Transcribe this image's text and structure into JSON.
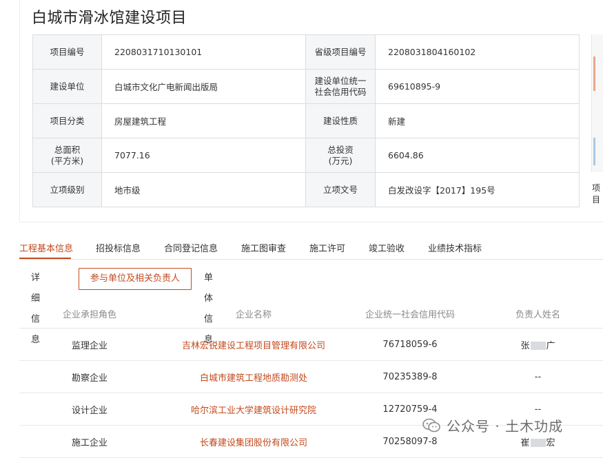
{
  "page": {
    "title": "白城市滑冰馆建设项目"
  },
  "info_table": {
    "rows": [
      [
        {
          "label": "项目编号",
          "value": "2208031710130101"
        },
        {
          "label": "省级项目编号",
          "value": "2208031804160102"
        }
      ],
      [
        {
          "label": "建设单位",
          "value": "白城市文化广电新闻出版局"
        },
        {
          "label_lines": [
            "建设单位统一",
            "社会信用代码"
          ],
          "value": "69610895-9"
        }
      ],
      [
        {
          "label": "项目分类",
          "value": "房屋建筑工程"
        },
        {
          "label": "建设性质",
          "value": "新建"
        }
      ],
      [
        {
          "label_lines": [
            "总面积",
            "(平方米)"
          ],
          "value": "7077.16"
        },
        {
          "label_lines": [
            "总投资",
            "(万元)"
          ],
          "value": "6604.86"
        }
      ],
      [
        {
          "label": "立项级别",
          "value": "地市级"
        },
        {
          "label": "立项文号",
          "value": "白发改设字【2017】195号"
        }
      ]
    ]
  },
  "side_panel": {
    "text": "项目"
  },
  "tabs": [
    {
      "label": "工程基本信息",
      "active": true
    },
    {
      "label": "招投标信息",
      "active": false
    },
    {
      "label": "合同登记信息",
      "active": false
    },
    {
      "label": "施工图审查",
      "active": false
    },
    {
      "label": "施工许可",
      "active": false
    },
    {
      "label": "竣工验收",
      "active": false
    },
    {
      "label": "业绩技术指标",
      "active": false
    }
  ],
  "subtabs": [
    {
      "label": "详细信息",
      "active": false
    },
    {
      "label": "参与单位及相关负责人",
      "active": true
    },
    {
      "label": "单体信息",
      "active": false
    }
  ],
  "participants": {
    "columns": [
      "企业承担角色",
      "企业名称",
      "企业统一社会信用代码",
      "负责人姓名"
    ],
    "rows": [
      {
        "role": "监理企业",
        "name": "吉林宏锐建设工程项目管理有限公司",
        "code": "76718059-6",
        "person_first": "张",
        "person_last": "广"
      },
      {
        "role": "勘察企业",
        "name": "白城市建筑工程地质勘测处",
        "code": "70235389-8",
        "person_text": "--"
      },
      {
        "role": "设计企业",
        "name": "哈尔滨工业大学建筑设计研究院",
        "code": "12720759-4",
        "person_text": "--"
      },
      {
        "role": "施工企业",
        "name": "长春建设集团股份有限公司",
        "code": "70258097-8",
        "person_first": "崔",
        "person_last": "宏"
      }
    ]
  },
  "watermark": {
    "text": "公众号 · 土木功成"
  },
  "colors": {
    "accent": "#c34a1d",
    "label_bg": "#f5f6f8",
    "border": "#dcdcdc"
  }
}
